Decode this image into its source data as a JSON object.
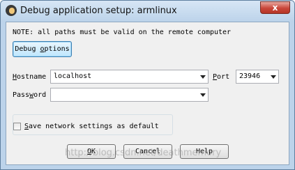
{
  "window": {
    "title": "Debug application setup: armlinux",
    "close_label": "x"
  },
  "note": "NOTE: all paths must be valid on the remote computer",
  "debug_options": {
    "prefix": "Debug ",
    "underlined": "o",
    "suffix": "ptions"
  },
  "hostname": {
    "label_prefix": "",
    "label_underlined": "H",
    "label_suffix": "ostname",
    "value": "localhost"
  },
  "port": {
    "label_prefix": "",
    "label_underlined": "P",
    "label_suffix": "ort",
    "value": "23946"
  },
  "password": {
    "label_prefix": "Pass",
    "label_underlined": "w",
    "label_suffix": "ord",
    "value": ""
  },
  "save_settings": {
    "checked": false,
    "label_prefix": "",
    "label_underlined": "S",
    "label_suffix": "ave network settings as default"
  },
  "buttons": {
    "ok": {
      "prefix": "",
      "underlined": "O",
      "suffix": "K"
    },
    "cancel": "Cancel",
    "help": "Help"
  },
  "watermark": "http://blog.csdn.net/deathmemory"
}
